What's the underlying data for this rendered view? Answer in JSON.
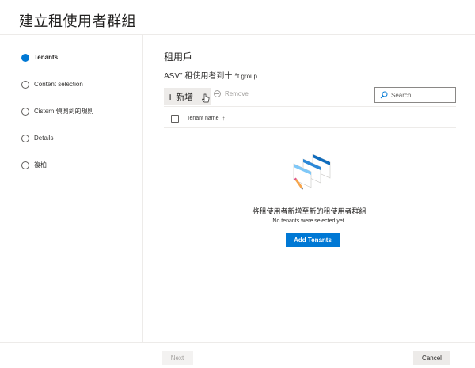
{
  "page": {
    "title": "建立租使用者群組"
  },
  "steps": [
    {
      "label": "Tenants",
      "active": true
    },
    {
      "label": "Content selection",
      "active": false
    },
    {
      "label": "Cistern 偵測到的規則",
      "active": false
    },
    {
      "label": "Details",
      "active": false
    },
    {
      "label": "複柏",
      "active": false
    }
  ],
  "main": {
    "section_title": "租用戶",
    "description": "ASV\" 租使用者到十 *",
    "description_suffix": "t group."
  },
  "toolbar": {
    "add_label": "新增",
    "remove_label": "Remove",
    "search_placeholder": "Search"
  },
  "table": {
    "columns": [
      "Tenant name"
    ]
  },
  "empty_state": {
    "title": "將租使用者新增至新的租使用者群組",
    "subtitle": "No tenants were selected yet.",
    "button_label": "Add Tenants"
  },
  "footer": {
    "next_label": "Next",
    "cancel_label": "Cancel"
  },
  "colors": {
    "accent": "#0078d4",
    "border": "#edebe9",
    "disabled_text": "#a19f9d"
  },
  "icons": [
    "plus-icon",
    "remove-icon",
    "search-icon",
    "sort-arrow-icon",
    "mouse-cursor-icon",
    "empty-tenants-illustration"
  ]
}
